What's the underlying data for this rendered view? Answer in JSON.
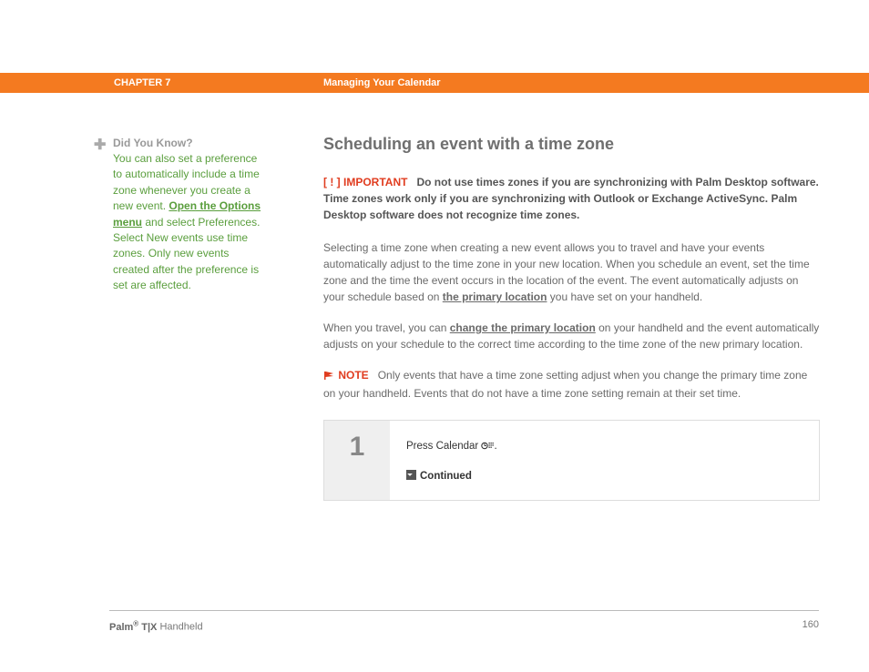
{
  "header": {
    "chapter": "CHAPTER 7",
    "title": "Managing Your Calendar"
  },
  "sidebar": {
    "dyk_title": "Did You Know?",
    "dyk_before": "You can also set a preference to automatically include a time zone whenever you create a new event. ",
    "dyk_link": "Open the Options menu",
    "dyk_after": " and select Preferences. Select New events use time zones. Only new events created after the preference is set are affected."
  },
  "main": {
    "title": "Scheduling an event with a time zone",
    "important_label": "IMPORTANT",
    "important_text": "Do not use times zones if you are synchronizing with Palm Desktop software. Time zones work only if you are synchronizing with Outlook or Exchange ActiveSync. Palm Desktop software does not recognize time zones.",
    "p1_before": "Selecting a time zone when creating a new event allows you to travel and have your events automatically adjust to the time zone in your new location. When you schedule an event, set the time zone and the time the event occurs in the location of the event. The event automatically adjusts on your schedule based on ",
    "p1_link": "the primary location",
    "p1_after": " you have set on your handheld.",
    "p2_before": "When you travel, you can ",
    "p2_link": "change the primary location",
    "p2_after": " on your handheld and the event automatically adjusts on your schedule to the correct time according to the time zone of the new primary location.",
    "note_label": "NOTE",
    "note_text": "Only events that have a time zone setting adjust when you change the primary time zone on your handheld. Events that do not have a time zone setting remain at their set time.",
    "step": {
      "num": "1",
      "text": "Press Calendar ",
      "period": ".",
      "continued": "Continued"
    }
  },
  "footer": {
    "brand": "Palm",
    "reg": "®",
    "model": " T|X",
    "suffix": " Handheld",
    "page": "160"
  }
}
